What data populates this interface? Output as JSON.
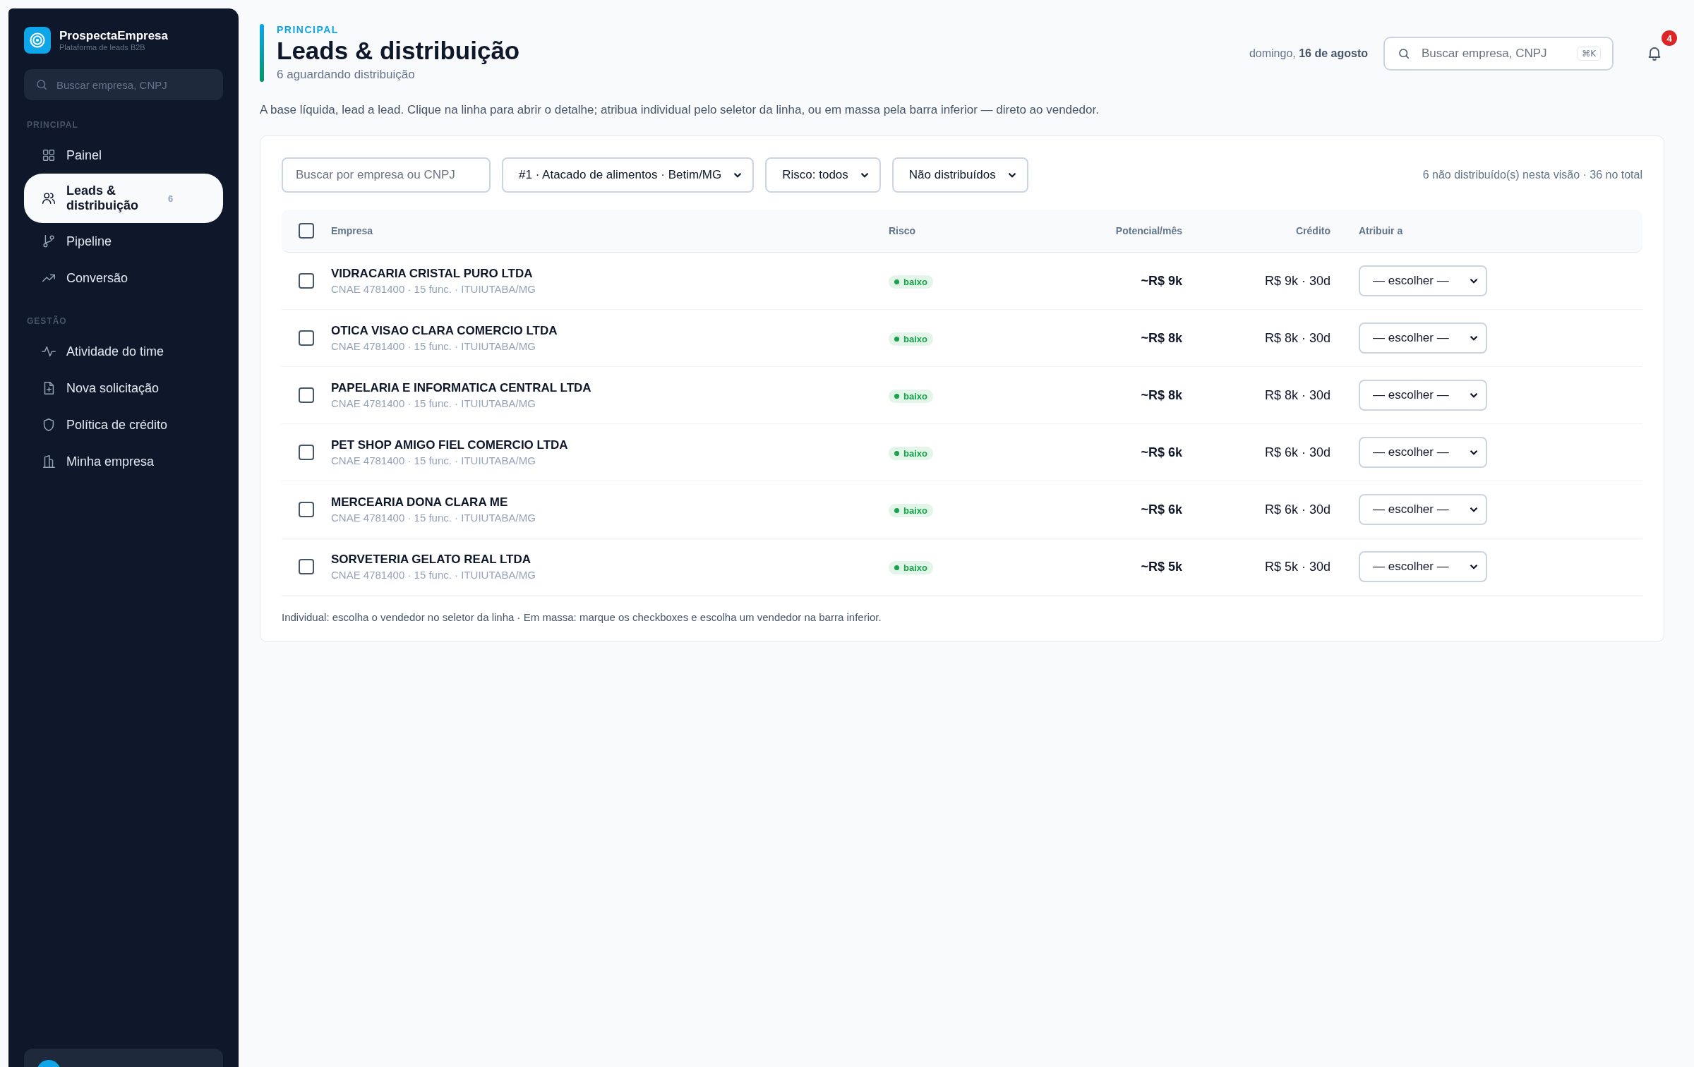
{
  "sidebar": {
    "brand": {
      "name": "ProspectaEmpresa",
      "subtitle": "Plataforma de leads B2B"
    },
    "search": {
      "placeholder": "Buscar empresa, CNPJ"
    },
    "sections": [
      {
        "title": "PRINCIPAL",
        "items": [
          {
            "label": "Painel",
            "selected": false
          },
          {
            "label": "Leads & distribuição",
            "selected": true,
            "badge": "6"
          },
          {
            "label": "Pipeline",
            "selected": false
          },
          {
            "label": "Conversão",
            "selected": false
          }
        ]
      },
      {
        "title": "GESTÃO",
        "items": [
          {
            "label": "Atividade do time",
            "selected": false
          },
          {
            "label": "Nova solicitação",
            "selected": false
          },
          {
            "label": "Política de crédito",
            "selected": false
          },
          {
            "label": "Minha empresa",
            "selected": false
          }
        ]
      }
    ]
  },
  "header": {
    "eyebrow": "PRINCIPAL",
    "title": "Leads & distribuição",
    "subtitle": "6 aguardando distribuição",
    "date": "domingo, **16 de agosto**",
    "search": {
      "placeholder": "Buscar empresa, CNPJ",
      "shortcut": "⌘K"
    },
    "notifications": "4"
  },
  "description": "A base líquida, lead a lead. Clique na linha para abrir o detalhe; atribua individual pelo seletor da linha, ou em massa pela barra inferior — direto ao vendedor.",
  "filters": {
    "search": {
      "placeholder": "Buscar por empresa ou CNPJ"
    },
    "selects": [
      "#1 · Atacado de alimentos · Betim/MG",
      "Risco: todos",
      "Não distribuídos"
    ],
    "summary": "6 não distribuído(s) nesta visão · 36 no total"
  },
  "table": {
    "select_all": {
      "checked": false
    },
    "columns": [
      "Empresa",
      "Risco",
      "Potencial/mês",
      "Crédito",
      "Atribuir a"
    ],
    "rows": [
      {
        "selected": false,
        "company": "VIDRACARIA CRISTAL PURO LTDA",
        "details": "CNAE 4781400 · 15 func. · ITUIUTABA/MG",
        "risk": "baixo",
        "color": "#16a34a",
        "potential": "~R$ 9k",
        "credit": "R$ 9k · 30d",
        "assign": "— escolher —"
      },
      {
        "selected": false,
        "company": "OTICA VISAO CLARA COMERCIO LTDA",
        "details": "CNAE 4781400 · 15 func. · ITUIUTABA/MG",
        "risk": "baixo",
        "color": "#16a34a",
        "potential": "~R$ 8k",
        "credit": "R$ 8k · 30d",
        "assign": "— escolher —"
      },
      {
        "selected": false,
        "company": "PAPELARIA E INFORMATICA CENTRAL LTDA",
        "details": "CNAE 4781400 · 15 func. · ITUIUTABA/MG",
        "risk": "baixo",
        "color": "#16a34a",
        "potential": "~R$ 8k",
        "credit": "R$ 8k · 30d",
        "assign": "— escolher —"
      },
      {
        "selected": false,
        "company": "PET SHOP AMIGO FIEL COMERCIO LTDA",
        "details": "CNAE 4781400 · 15 func. · ITUIUTABA/MG",
        "risk": "baixo",
        "color": "#16a34a",
        "potential": "~R$ 6k",
        "credit": "R$ 6k · 30d",
        "assign": "— escolher —"
      },
      {
        "selected": false,
        "company": "MERCEARIA DONA CLARA ME",
        "details": "CNAE 4781400 · 15 func. · ITUIUTABA/MG",
        "risk": "baixo",
        "color": "#16a34a",
        "potential": "~R$ 6k",
        "credit": "R$ 6k · 30d",
        "assign": "— escolher —"
      },
      {
        "selected": false,
        "company": "SORVETERIA GELATO REAL LTDA",
        "details": "CNAE 4781400 · 15 func. · ITUIUTABA/MG",
        "risk": "baixo",
        "color": "#16a34a",
        "potential": "~R$ 5k",
        "credit": "R$ 5k · 30d",
        "assign": "— escolher —"
      }
    ],
    "footnote": "Individual: escolha o vendedor no seletor da linha · Em massa: marque os checkboxes e escolha um vendedor na barra inferior."
  }
}
